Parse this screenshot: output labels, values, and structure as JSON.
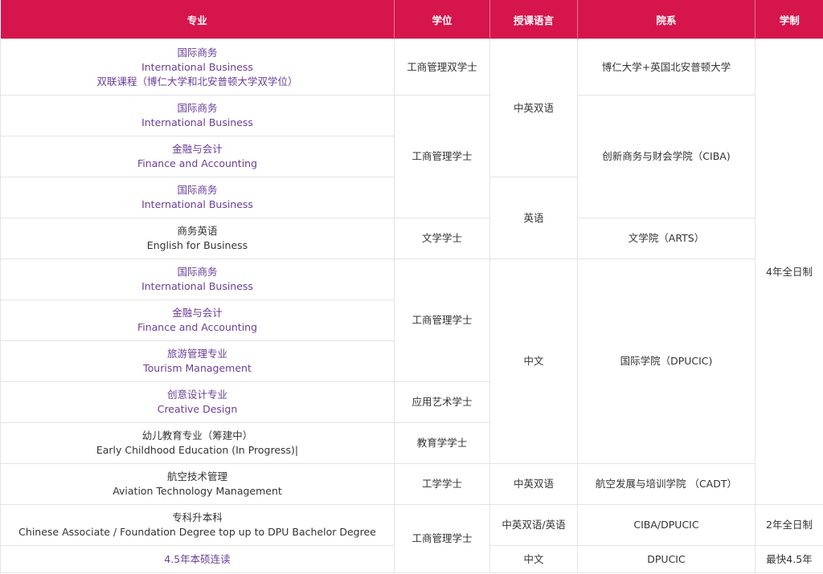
{
  "headers": {
    "major": "专业",
    "degree": "学位",
    "language": "授课语言",
    "school": "院系",
    "duration": "学制"
  },
  "rows": [
    {
      "major_lines": [
        "国际商务",
        "International Business",
        "双联课程（博仁大学和北安普顿大学双学位）"
      ]
    },
    {
      "major_lines": [
        "国际商务",
        "International Business"
      ]
    },
    {
      "major_lines": [
        "金融与会计",
        "Finance and Accounting"
      ]
    },
    {
      "major_lines": [
        "国际商务",
        "International Business"
      ]
    },
    {
      "major_lines": [
        "商务英语",
        "English for Business"
      ]
    },
    {
      "major_lines": [
        "国际商务",
        "International Business"
      ]
    },
    {
      "major_lines": [
        "金融与会计",
        "Finance and Accounting"
      ]
    },
    {
      "major_lines": [
        "旅游管理专业",
        "Tourism Management"
      ]
    },
    {
      "major_lines": [
        "创意设计专业",
        "Creative Design"
      ]
    },
    {
      "major_lines": [
        "幼儿教育专业（筹建中）",
        "Early Childhood Education (In Progress)|"
      ]
    },
    {
      "major_lines": [
        "航空技术管理",
        "Aviation Technology Management"
      ]
    },
    {
      "major_lines": [
        "专科升本科",
        "Chinese Associate / Foundation Degree top up to DPU Bachelor Degree"
      ]
    },
    {
      "major_lines": [
        "4.5年本硕连读"
      ]
    }
  ],
  "degrees": {
    "dual_bachelor": "工商管理双学士",
    "bba_1": "工商管理学士",
    "arts": "文学学士",
    "bba_2": "工商管理学士",
    "applied_arts": "应用艺术学士",
    "education": "教育学学士",
    "engineering": "工学学士",
    "bba_3": "工商管理学士"
  },
  "languages": {
    "bilingual_1": "中英双语",
    "english": "英语",
    "chinese_1": "中文",
    "bilingual_2": "中英双语",
    "bilingual_or_english": "中英双语/英语",
    "chinese_2": "中文"
  },
  "schools": {
    "joint": "博仁大学+英国北安普顿大学",
    "ciba": "创新商务与财会学院（CIBA)",
    "arts": "文学院（ARTS）",
    "dpucic": "国际学院（DPUCIC)",
    "cadt": "航空发展与培训学院 （CADT）",
    "ciba_dpucic": "CIBA/DPUCIC",
    "dpucic_short": "DPUCIC"
  },
  "durations": {
    "four_year": "4年全日制",
    "two_year": "2年全日制",
    "fastest": "最快4.5年"
  }
}
